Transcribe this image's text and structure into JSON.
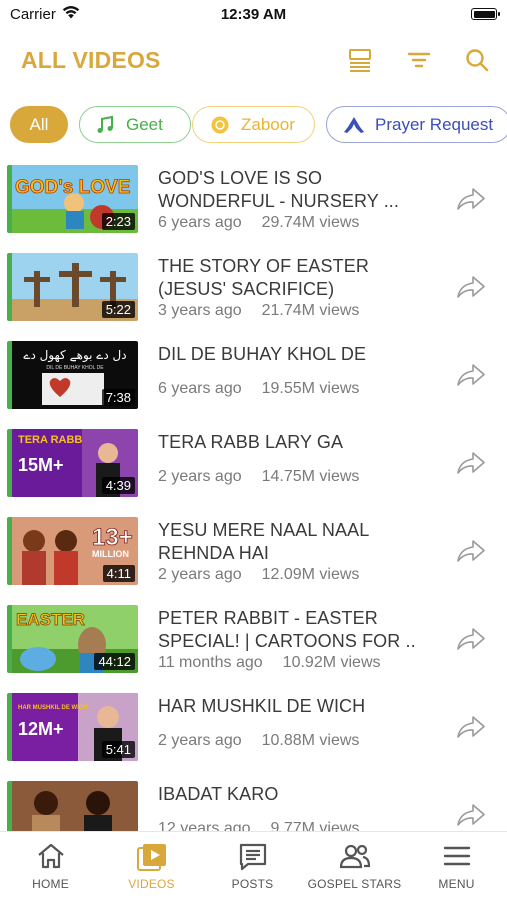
{
  "status_bar": {
    "carrier": "Carrier",
    "time": "12:39 AM"
  },
  "header": {
    "title": "ALL VIDEOS",
    "icons": [
      "list-view-icon",
      "filter-icon",
      "search-icon"
    ]
  },
  "colors": {
    "accent": "#d9a83a",
    "thumb_stripe": "#47b04b",
    "chip_geet": "#47b04b",
    "chip_zaboor": "#f3c33d",
    "chip_prayer": "#3a4fb7"
  },
  "chips": [
    {
      "label": "All",
      "active": true
    },
    {
      "label": "Geet",
      "icon": "music-note-icon"
    },
    {
      "label": "Zaboor",
      "icon": "circle-icon"
    },
    {
      "label": "Prayer Request",
      "icon": "praying-hands-icon"
    }
  ],
  "videos": [
    {
      "title_line1": "GOD'S LOVE IS SO",
      "title_line2": "WONDERFUL - NURSERY ...",
      "age": "6 years ago",
      "views": "29.74M views",
      "duration": "2:23",
      "thumb_text": "GOD's LOVE"
    },
    {
      "title_line1": "THE STORY OF EASTER",
      "title_line2": "(JESUS' SACRIFICE)",
      "age": "3 years ago",
      "views": "21.74M views",
      "duration": "5:22",
      "thumb_text": ""
    },
    {
      "title_line1": "DIL DE BUHAY KHOL DE",
      "title_line2": "",
      "age": "6 years ago",
      "views": "19.55M views",
      "duration": "7:38",
      "thumb_text": "دل دے بوھے کھول دے",
      "thumb_subtext": "DIL DE BUHAY KHOL DE"
    },
    {
      "title_line1": "TERA RABB LARY GA",
      "title_line2": "",
      "age": "2 years ago",
      "views": "14.75M views",
      "duration": "4:39",
      "thumb_text": "TERA RABB",
      "thumb_badge": "15M+"
    },
    {
      "title_line1": "YESU MERE NAAL NAAL",
      "title_line2": "REHNDA HAI",
      "age": "2 years ago",
      "views": "12.09M views",
      "duration": "4:11",
      "thumb_text": "13+",
      "thumb_subtext": "MILLION"
    },
    {
      "title_line1": "PETER RABBIT - EASTER",
      "title_line2": "SPECIAL! | CARTOONS FOR ...",
      "age": "11 months ago",
      "views": "10.92M views",
      "duration": "44:12",
      "thumb_text": "EASTER"
    },
    {
      "title_line1": "HAR MUSHKIL DE WICH",
      "title_line2": "",
      "age": "2 years ago",
      "views": "10.88M views",
      "duration": "5:41",
      "thumb_text": "HAR MUSHKIL DE WICH",
      "thumb_badge": "12M+"
    },
    {
      "title_line1": "IBADAT KARO",
      "title_line2": "",
      "age": "12 years ago",
      "views": "9.77M views",
      "duration": ""
    }
  ],
  "tabs": [
    {
      "label": "HOME",
      "icon": "home-icon"
    },
    {
      "label": "VIDEOS",
      "icon": "video-library-icon",
      "active": true
    },
    {
      "label": "POSTS",
      "icon": "posts-icon"
    },
    {
      "label": "GOSPEL STARS",
      "icon": "people-icon"
    },
    {
      "label": "MENU",
      "icon": "menu-icon"
    }
  ]
}
